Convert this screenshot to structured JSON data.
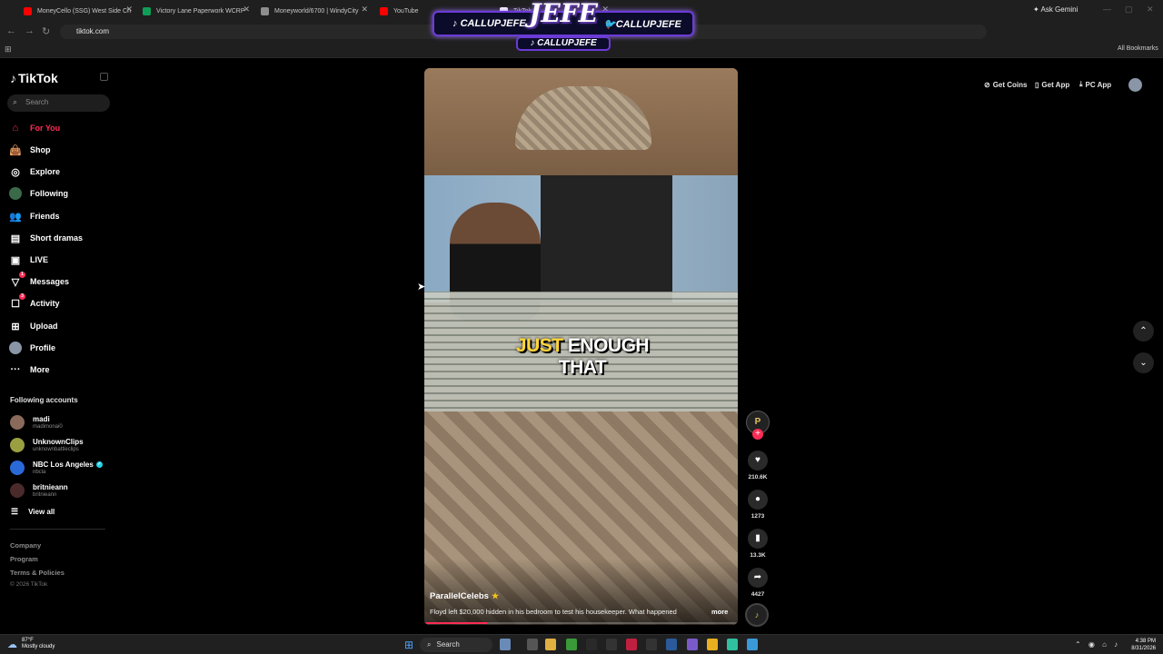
{
  "browser": {
    "tabs": [
      {
        "label": "MoneyCello (SSG) West Side Ch",
        "color": "#ff0000"
      },
      {
        "label": "Victory Lane Paperwork WCRP",
        "color": "#0f9d58"
      },
      {
        "label": "Moneyworld/6700 | WindyCity",
        "color": "#8e8e8e"
      },
      {
        "label": "YouTube",
        "color": "#ff0000"
      },
      {
        "label": "TikTok",
        "color": "#ffffff"
      }
    ],
    "ask_gemini": "Ask Gemini",
    "url": "tiktok.com",
    "all_bookmarks": "All Bookmarks"
  },
  "stream_overlay": {
    "title": "JEFE",
    "left_handle": "CALLUPJEFE",
    "right_handle": "CALLUPJEFE",
    "bottom_handle": "CALLUPJEFE"
  },
  "sidebar": {
    "logo": "TikTok",
    "search_placeholder": "Search",
    "menu": [
      {
        "label": "For You",
        "icon": "home-icon",
        "active": true
      },
      {
        "label": "Shop",
        "icon": "shop-bag-icon"
      },
      {
        "label": "Explore",
        "icon": "compass-icon"
      },
      {
        "label": "Following",
        "icon": "following-avatar-icon"
      },
      {
        "label": "Friends",
        "icon": "friends-icon"
      },
      {
        "label": "Short dramas",
        "icon": "film-icon"
      },
      {
        "label": "LIVE",
        "icon": "live-tv-icon"
      },
      {
        "label": "Messages",
        "icon": "messages-icon",
        "badge": "1"
      },
      {
        "label": "Activity",
        "icon": "activity-icon",
        "badge": "3"
      },
      {
        "label": "Upload",
        "icon": "upload-icon"
      },
      {
        "label": "Profile",
        "icon": "profile-avatar-icon"
      },
      {
        "label": "More",
        "icon": "more-dots-icon"
      }
    ],
    "following_title": "Following accounts",
    "accounts": [
      {
        "name": "madi",
        "handle": "madimonai0",
        "color": "#8a6a5a"
      },
      {
        "name": "UnknownClips",
        "handle": "unknownbattleclips",
        "color": "#9aa040"
      },
      {
        "name": "NBC Los Angeles",
        "handle": "nbcla",
        "color": "#2a6ad8",
        "verified": true
      },
      {
        "name": "britnieann",
        "handle": "britnieann",
        "color": "#4a2a2a"
      }
    ],
    "view_all": "View all",
    "footer": [
      "Company",
      "Program",
      "Terms & Policies"
    ],
    "copyright": "© 2026 TikTok"
  },
  "header": {
    "get_coins": "Get Coins",
    "get_app": "Get App",
    "pc_app": "PC App"
  },
  "video": {
    "caption_highlight": "JUST",
    "caption_rest": "ENOUGH THAT",
    "author": "ParallelCelebs",
    "description": "Floyd left $20,000 hidden in his bedroom to test his housekeeper. What happened",
    "more": "more",
    "progress": 0.2
  },
  "actions": {
    "likes": "210.6K",
    "comments": "1273",
    "saves": "13.3K",
    "shares": "4427"
  },
  "taskbar": {
    "temp": "87°F",
    "weather": "Mostly cloudy",
    "search": "Search",
    "time": "4:38 PM",
    "date": "8/31/2026"
  }
}
